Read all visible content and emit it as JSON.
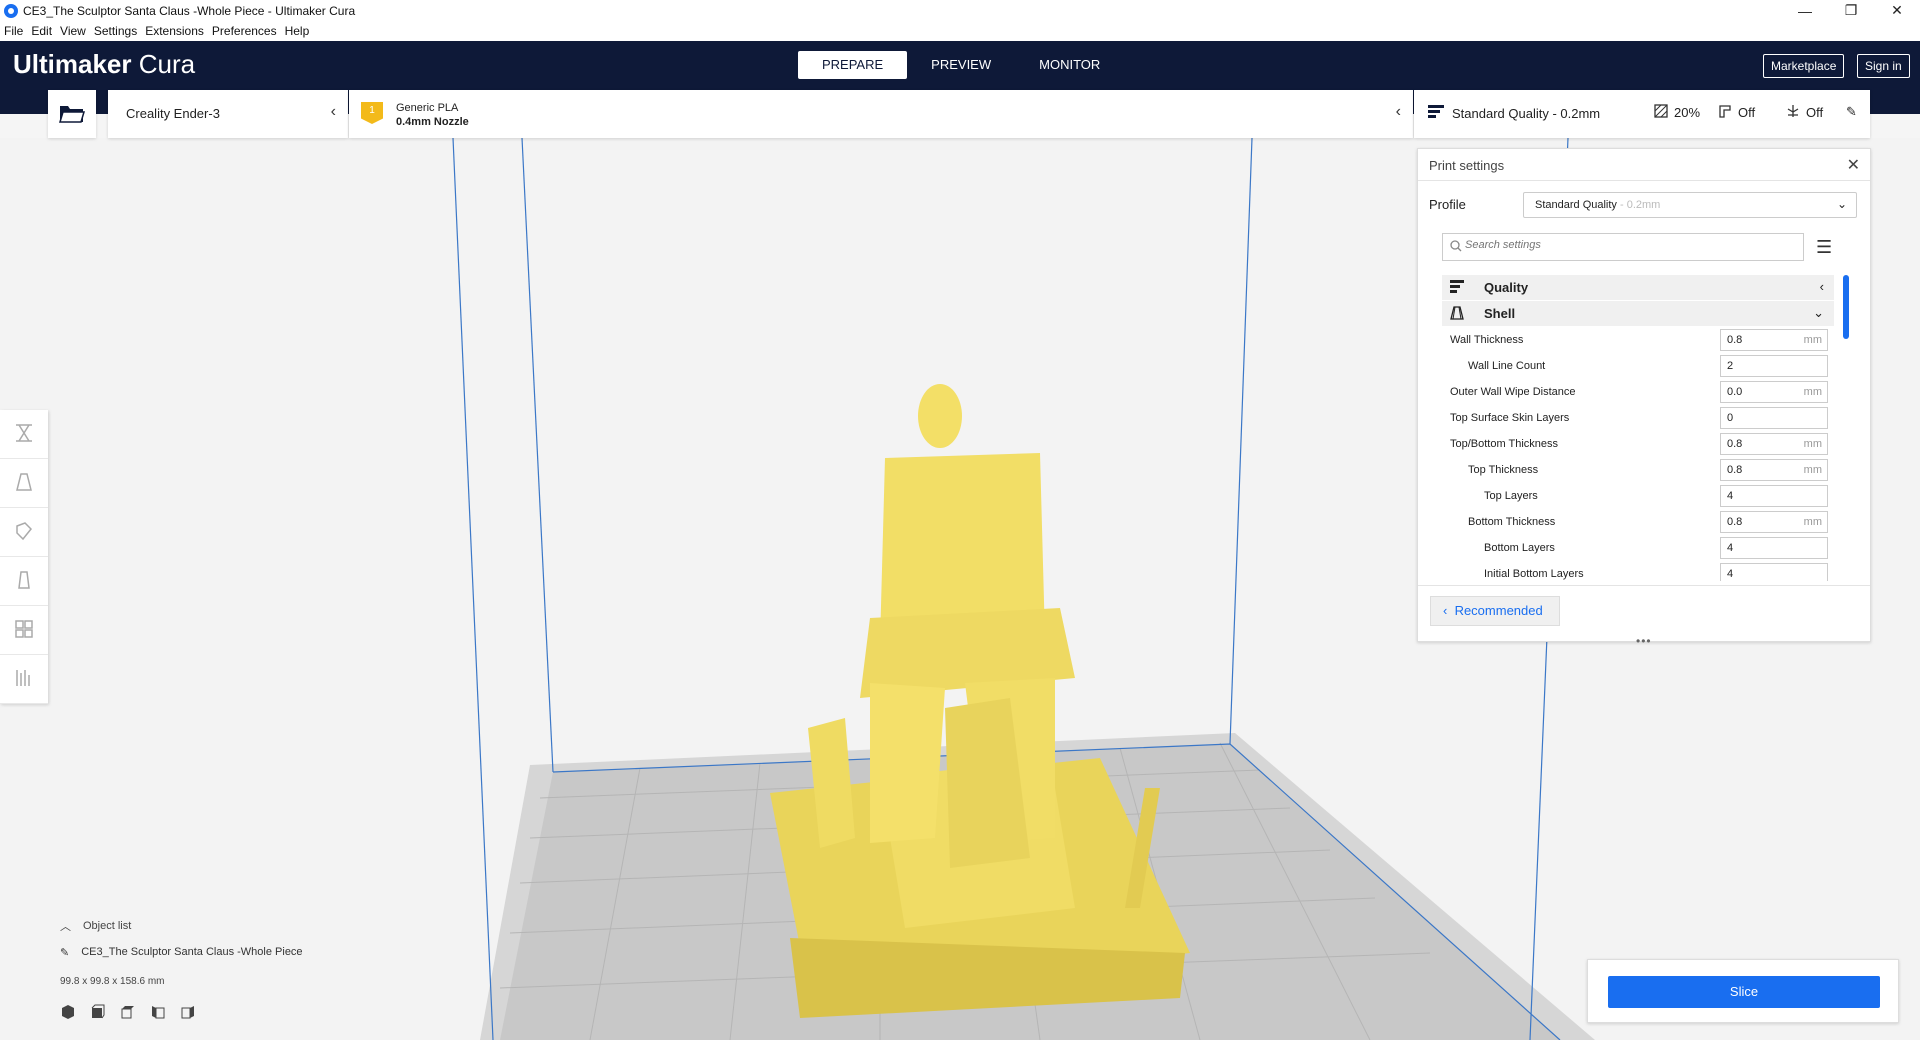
{
  "window": {
    "title": "CE3_The Sculptor Santa Claus -Whole Piece - Ultimaker Cura",
    "controls": [
      "—",
      "❐",
      "✕"
    ]
  },
  "menu": [
    "File",
    "Edit",
    "View",
    "Settings",
    "Extensions",
    "Preferences",
    "Help"
  ],
  "brand": {
    "part1": "Ultimaker",
    "part2": " Cura"
  },
  "stages": {
    "prepare": "PREPARE",
    "preview": "PREVIEW",
    "monitor": "MONITOR"
  },
  "header_buttons": {
    "marketplace": "Marketplace",
    "signin": "Sign in"
  },
  "printer": {
    "name": "Creality Ender-3"
  },
  "material": {
    "extruder": "1",
    "name": "Generic PLA",
    "nozzle": "0.4mm Nozzle"
  },
  "quality_bar": {
    "profile": "Standard Quality - 0.2mm",
    "infill": "20%",
    "support": "Off",
    "adhesion": "Off"
  },
  "print_settings": {
    "title": "Print settings",
    "profile_label": "Profile",
    "profile_value": "Standard Quality",
    "profile_suffix": " - 0.2mm",
    "search_placeholder": "Search settings",
    "categories": {
      "quality": "Quality",
      "shell": "Shell"
    },
    "settings": [
      {
        "label": "Wall Thickness",
        "value": "0.8",
        "unit": "mm"
      },
      {
        "label": "Wall Line Count",
        "value": "2",
        "unit": ""
      },
      {
        "label": "Outer Wall Wipe Distance",
        "value": "0.0",
        "unit": "mm"
      },
      {
        "label": "Top Surface Skin Layers",
        "value": "0",
        "unit": ""
      },
      {
        "label": "Top/Bottom Thickness",
        "value": "0.8",
        "unit": "mm"
      },
      {
        "label": "Top Thickness",
        "value": "0.8",
        "unit": "mm"
      },
      {
        "label": "Top Layers",
        "value": "4",
        "unit": ""
      },
      {
        "label": "Bottom Thickness",
        "value": "0.8",
        "unit": "mm"
      },
      {
        "label": "Bottom Layers",
        "value": "4",
        "unit": ""
      },
      {
        "label": "Initial Bottom Layers",
        "value": "4",
        "unit": ""
      }
    ],
    "recommended_label": "Recommended"
  },
  "object_list": {
    "toggle_label": "Object list",
    "object_name": "CE3_The Sculptor Santa Claus -Whole Piece",
    "dimensions": "99.8 x 99.8 x 158.6 mm"
  },
  "slice": {
    "button_label": "Slice"
  },
  "colors": {
    "header": "#0e1938",
    "accent": "#196ef0",
    "model": "#f6e26b",
    "badge": "#f3ba1a"
  }
}
